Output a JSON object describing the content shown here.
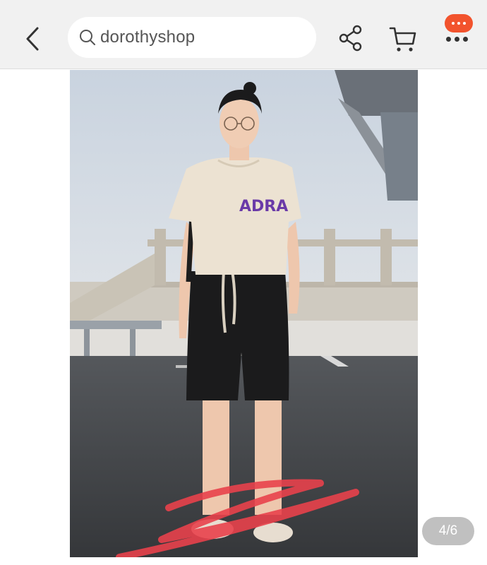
{
  "header": {
    "search_text": "dorothyshop"
  },
  "product": {
    "shirt_print": "ADRA"
  },
  "gallery": {
    "counter": "4/6"
  },
  "colors": {
    "accent": "#f2532d",
    "scribble": "#e8414b",
    "topbar": "#f1f1f1"
  }
}
